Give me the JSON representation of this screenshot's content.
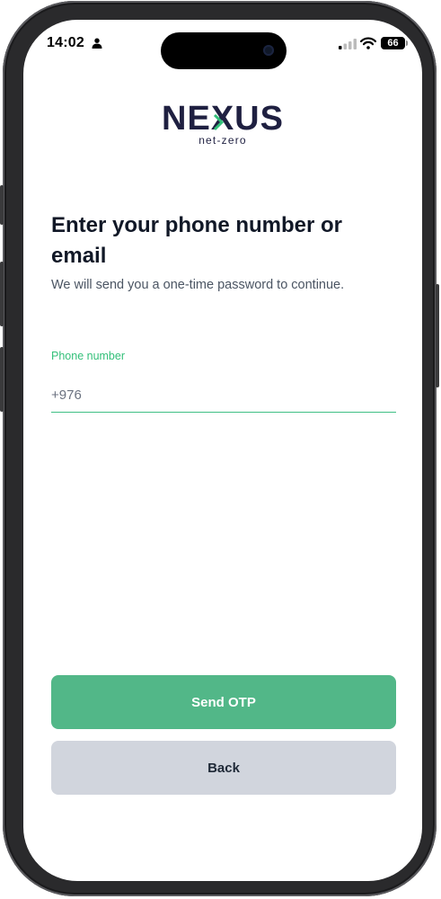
{
  "status_bar": {
    "time": "14:02",
    "battery_level": "66",
    "icons": [
      "person-icon",
      "signal-icon",
      "wifi-icon",
      "battery-icon"
    ]
  },
  "brand": {
    "name": "NEXUS",
    "tagline": "net-zero",
    "color_primary": "#1f2041",
    "color_accent": "#34c07a"
  },
  "login": {
    "heading": "Enter your phone number or email",
    "subtitle": "We will send you a one-time password to continue.",
    "phone_label": "Phone number",
    "phone_value": "+976"
  },
  "actions": {
    "send_label": "Send OTP",
    "back_label": "Back",
    "send_color": "#52b788",
    "back_color": "#d1d5dd"
  }
}
